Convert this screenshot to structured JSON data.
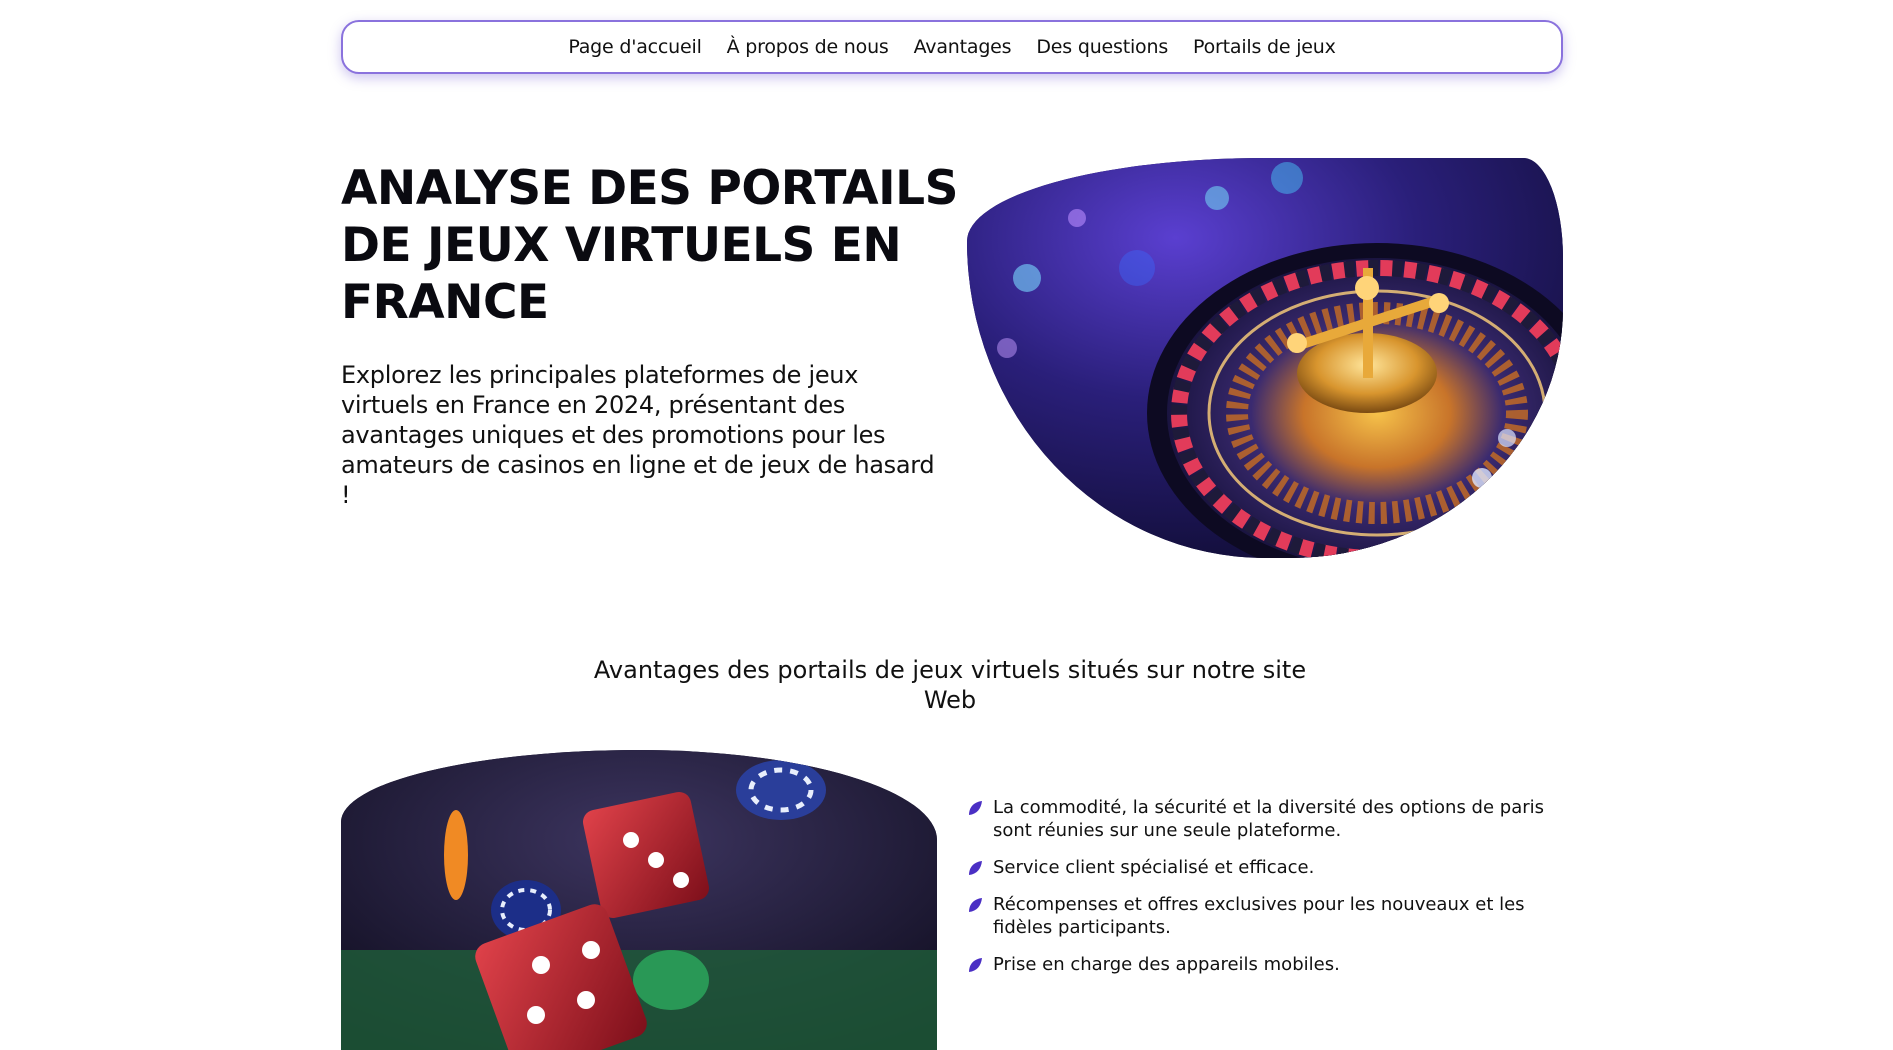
{
  "nav": {
    "items": [
      {
        "label": "Page d'accueil"
      },
      {
        "label": "À propos de nous"
      },
      {
        "label": "Avantages"
      },
      {
        "label": "Des questions"
      },
      {
        "label": "Portails de jeux"
      }
    ]
  },
  "hero": {
    "title": "ANALYSE DES PORTAILS DE JEUX VIRTUELS EN FRANCE",
    "text": "Explorez les principales plateformes de jeux virtuels en France en 2024, présentant des avantages uniques et des promotions pour les amateurs de casinos en ligne et de jeux de hasard !",
    "image": "roulette-wheel-photo"
  },
  "advantages": {
    "title": "Avantages des portails de jeux virtuels situés sur notre site Web",
    "image": "dice-and-chips-photo",
    "icon": "leaf-bullet-icon",
    "accent_color": "#4a2fc4",
    "items": [
      {
        "text": "La commodité, la sécurité et la diversité des options de paris sont réunies sur une seule plateforme."
      },
      {
        "text": "Service client spécialisé et efficace."
      },
      {
        "text": "Récompenses et offres exclusives pour les nouveaux et les fidèles participants."
      },
      {
        "text": "Prise en charge des appareils mobiles."
      }
    ]
  }
}
